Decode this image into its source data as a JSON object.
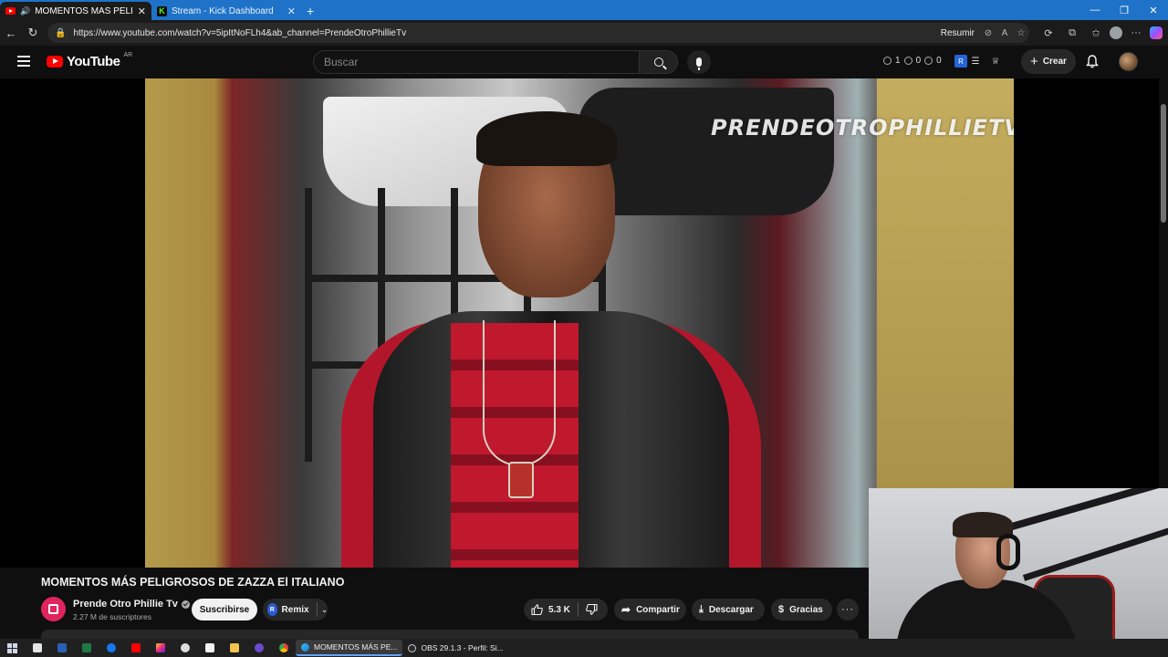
{
  "browser": {
    "tabs": [
      {
        "title": "MOMENTOS MÁS PELIGROS",
        "active": true
      },
      {
        "title": "Stream - Kick Dashboard",
        "active": false
      }
    ],
    "url": "https://www.youtube.com/watch?v=5ipItNoFLh4&ab_channel=PrendeOtroPhillieTv",
    "resumir_label": "Resumir",
    "icons": [
      "back-icon",
      "refresh-icon",
      "lock-icon",
      "star-icon",
      "extensions-icon",
      "favorites-icon",
      "profile-icon",
      "more-icon",
      "copilot-icon"
    ]
  },
  "youtube": {
    "logo_text": "YouTube",
    "country_code": "AR",
    "search_placeholder": "Buscar",
    "ext_counts": [
      "1",
      "0",
      "0"
    ],
    "create_label": "Crear"
  },
  "video": {
    "watermark": "PRENDEOTROPHILLIETV",
    "title": "MOMENTOS MÁS PELIGROSOS DE ZAZZA El ITALIANO",
    "channel_name": "Prende Otro Phillie Tv",
    "subscribers": "2.27 M de suscriptores",
    "subscribe_label": "Suscribirse",
    "remix_label": "Remix",
    "likes": "5.3 K",
    "share_label": "Compartir",
    "download_label": "Descargar",
    "thanks_label": "Gracias",
    "more_label": "···"
  },
  "taskbar": {
    "tasks": [
      {
        "label": "MOMENTOS MÁS PE...",
        "active": true
      },
      {
        "label": "OBS 29.1.3 - Perfil: Si...",
        "active": false
      }
    ]
  },
  "colors": {
    "youtube_red": "#ff0000",
    "browser_tabstrip": "#1e73c8",
    "background": "#0f0f0f",
    "pill": "#272727"
  }
}
